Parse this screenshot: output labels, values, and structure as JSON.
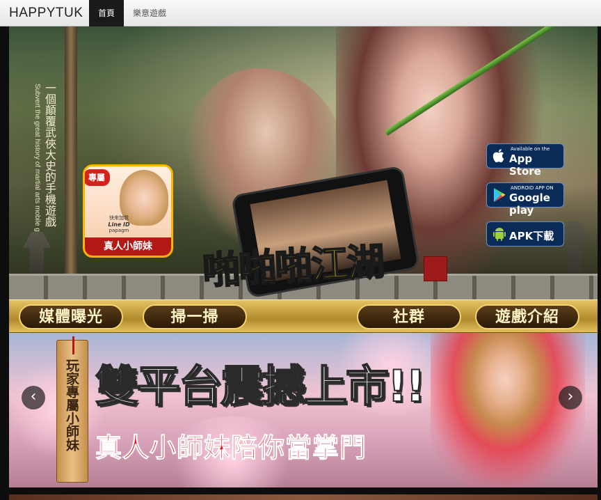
{
  "navbar": {
    "brand": "HAPPYTUK",
    "items": [
      {
        "label": "首頁",
        "active": true
      },
      {
        "label": "樂意遊戲",
        "active": false
      }
    ]
  },
  "hero": {
    "tagline_zh": "一個顛覆武俠大史的手機遊戲",
    "tagline_en": "Subvert the great history of martial arts mobile games",
    "promo_card": {
      "tag": "專屬",
      "add_text": "快來加我",
      "line_label": "Line ID",
      "line_id": "papagm",
      "name": "真人小師妹"
    },
    "game_logo": "啪啪啪江湖",
    "store_buttons": [
      {
        "small": "Available on the",
        "big": "App Store",
        "icon": "apple-icon"
      },
      {
        "small": "ANDROID APP ON",
        "big": "Google play",
        "icon": "google-play-icon"
      },
      {
        "small": "",
        "big": "APK下載",
        "icon": "android-icon"
      }
    ]
  },
  "menu": {
    "items": [
      "媒體曝光",
      "掃一掃",
      "社群",
      "遊戲介紹"
    ]
  },
  "banner": {
    "scroll_text": "玩家專屬小師妹",
    "headline": "雙平台震撼上市!!",
    "subline": "真人小師妹陪你當掌門",
    "prev_arrow": "‹",
    "next_arrow": "›"
  },
  "colors": {
    "accent_gold": "#f5d46b",
    "headline_red": "#e0151c",
    "navbar_active": "#1a1a1a"
  }
}
